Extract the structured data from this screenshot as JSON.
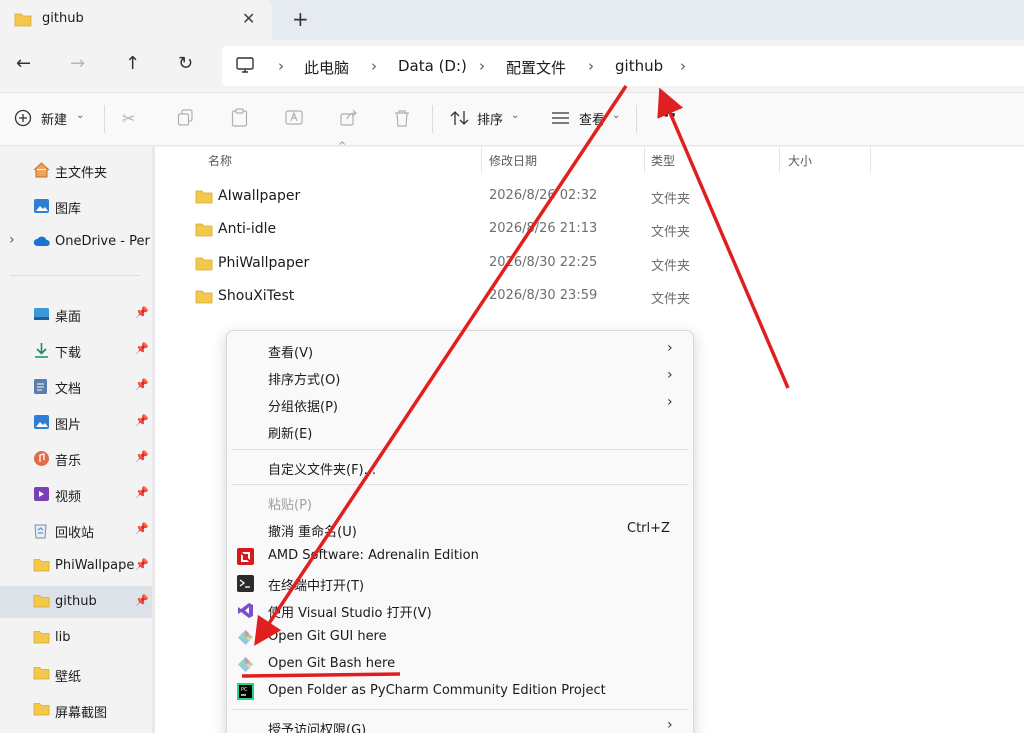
{
  "tab": {
    "title": "github",
    "close_glyph": "✕",
    "new_glyph": "+"
  },
  "nav": {
    "back": "←",
    "forward": "→",
    "up": "↑",
    "refresh": "↻"
  },
  "breadcrumb": {
    "items": [
      "此电脑",
      "Data (D:)",
      "配置文件",
      "github"
    ],
    "sep": "›"
  },
  "toolbar": {
    "new_label": "新建",
    "sort_label": "排序",
    "view_label": "查看",
    "more_glyph": "···"
  },
  "sidebar": {
    "items": [
      {
        "label": "主文件夹",
        "icon": "home-icon",
        "pinned": false
      },
      {
        "label": "图库",
        "icon": "gallery-icon",
        "pinned": false
      },
      {
        "label": "OneDrive - Per",
        "icon": "cloud-icon",
        "pinned": false
      },
      {
        "label": "桌面",
        "icon": "desktop-icon",
        "pinned": true
      },
      {
        "label": "下载",
        "icon": "download-icon",
        "pinned": true
      },
      {
        "label": "文档",
        "icon": "document-icon",
        "pinned": true
      },
      {
        "label": "图片",
        "icon": "pictures-icon",
        "pinned": true
      },
      {
        "label": "音乐",
        "icon": "music-icon",
        "pinned": true
      },
      {
        "label": "视频",
        "icon": "video-icon",
        "pinned": true
      },
      {
        "label": "回收站",
        "icon": "recycle-bin-icon",
        "pinned": true
      },
      {
        "label": "PhiWallpape",
        "icon": "folder-icon",
        "pinned": true
      },
      {
        "label": "github",
        "icon": "folder-icon",
        "pinned": true,
        "selected": true
      },
      {
        "label": "lib",
        "icon": "folder-icon",
        "pinned": false
      },
      {
        "label": "壁纸",
        "icon": "folder-icon",
        "pinned": false
      },
      {
        "label": "屏幕截图",
        "icon": "folder-icon",
        "pinned": false
      }
    ],
    "pin_glyph": "📌"
  },
  "columns": {
    "name": "名称",
    "modified": "修改日期",
    "type": "类型",
    "size": "大小"
  },
  "files": [
    {
      "name": "AIwallpaper",
      "modified": "2026/8/26 02:32",
      "type": "文件夹"
    },
    {
      "name": "Anti-idle",
      "modified": "2026/8/26 21:13",
      "type": "文件夹"
    },
    {
      "name": "PhiWallpaper",
      "modified": "2026/8/30 22:25",
      "type": "文件夹"
    },
    {
      "name": "ShouXiTest",
      "modified": "2026/8/30 23:59",
      "type": "文件夹"
    }
  ],
  "context_menu": {
    "view": "查看(V)",
    "sort": "排序方式(O)",
    "group": "分组依据(P)",
    "refresh": "刷新(E)",
    "customize": "自定义文件夹(F)...",
    "paste": "粘贴(P)",
    "undo": "撤消 重命名(U)",
    "undo_shortcut": "Ctrl+Z",
    "amd": "AMD Software: Adrenalin Edition",
    "terminal": "在终端中打开(T)",
    "vs": "使用 Visual Studio 打开(V)",
    "git_gui": "Open Git GUI here",
    "git_bash": "Open Git Bash here",
    "pycharm": "Open Folder as PyCharm Community Edition Project",
    "access": "授予访问权限(G)",
    "submenu_glyph": "›"
  },
  "colors": {
    "annotation": "#e02020",
    "accent": "#0067c0",
    "folder": "#f2c94c"
  }
}
